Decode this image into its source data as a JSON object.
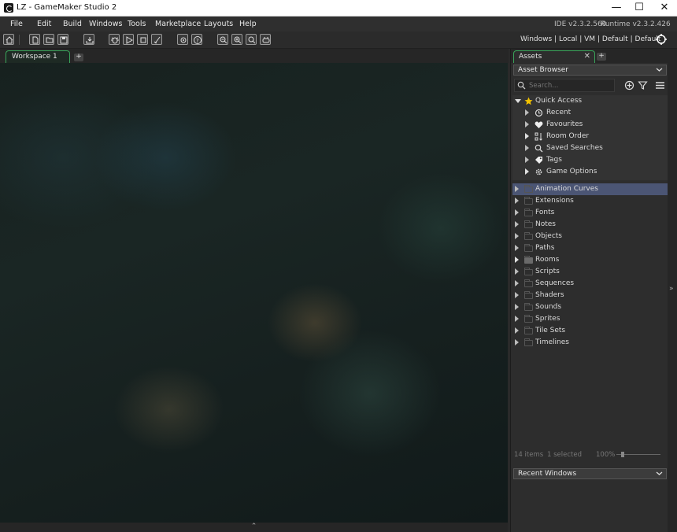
{
  "window": {
    "title": "LZ - GameMaker Studio 2",
    "controls": {
      "minimize": "—",
      "maximize": "☐",
      "close": "✕"
    }
  },
  "menu": {
    "items": [
      "File",
      "Edit",
      "Build",
      "Windows",
      "Tools",
      "Marketplace",
      "Layouts",
      "Help"
    ],
    "ide_version": "IDE v2.3.2.560",
    "runtime_version": "Runtime v2.3.2.426"
  },
  "toolbar": {
    "icons": [
      "home-icon",
      "new-project-icon",
      "open-project-icon",
      "save-icon",
      "create-executable-icon",
      "debug-icon",
      "run-icon",
      "stop-icon",
      "clean-icon",
      "preferences-icon",
      "help-icon",
      "zoom-out-icon",
      "zoom-in-icon",
      "zoom-reset-icon",
      "gamepad-icon"
    ],
    "target": {
      "platform": "Windows",
      "device": "Local",
      "output": "VM",
      "config": "Default",
      "targets": "Default",
      "sep": "|"
    }
  },
  "workspace": {
    "tab_label": "Workspace 1",
    "add_tab": "+",
    "bottom_toggle": "⌃"
  },
  "assets": {
    "tab_label": "Assets",
    "tab_close": "✕",
    "add_tab": "+",
    "browser_dropdown": "Asset Browser",
    "search_placeholder": "Search...",
    "quick_access": {
      "label": "Quick Access",
      "items": [
        {
          "label": "Recent",
          "icon": "history-icon"
        },
        {
          "label": "Favourites",
          "icon": "heart-icon"
        },
        {
          "label": "Room Order",
          "icon": "room-order-icon"
        },
        {
          "label": "Saved Searches",
          "icon": "search-icon"
        },
        {
          "label": "Tags",
          "icon": "tag-icon"
        },
        {
          "label": "Game Options",
          "icon": "gear-icon"
        }
      ]
    },
    "folders": [
      "Animation Curves",
      "Extensions",
      "Fonts",
      "Notes",
      "Objects",
      "Paths",
      "Rooms",
      "Scripts",
      "Sequences",
      "Shaders",
      "Sounds",
      "Sprites",
      "Tile Sets",
      "Timelines"
    ],
    "selected_folder": "Animation Curves",
    "status": {
      "count": "14 items",
      "selected": "1 selected",
      "zoom": "100%"
    },
    "recent_dropdown": "Recent Windows"
  },
  "colors": {
    "accent_green": "#3aa55a",
    "selection": "#4b5574",
    "star": "#f2c200"
  }
}
